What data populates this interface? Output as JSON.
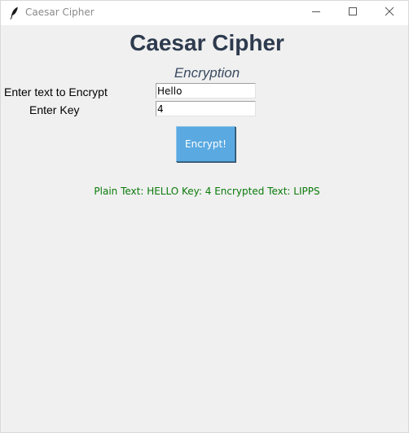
{
  "window": {
    "title": "Caesar Cipher",
    "controls": {
      "minimize": "minimize-icon",
      "maximize": "maximize-icon",
      "close": "close-icon"
    }
  },
  "app": {
    "heading": "Caesar Cipher",
    "subheading": "Encryption"
  },
  "form": {
    "text_label": "Enter text to Encrypt",
    "text_value": "Hello",
    "key_label": "Enter Key",
    "key_value": "4",
    "button_label": "Encrypt!"
  },
  "result": {
    "text": "Plain Text: HELLO Key: 4 Encrypted Text: LIPPS"
  },
  "colors": {
    "heading": "#2e3b4e",
    "button": "#5aa9e1",
    "result": "#0a7a0a",
    "background": "#f0f0f0"
  }
}
